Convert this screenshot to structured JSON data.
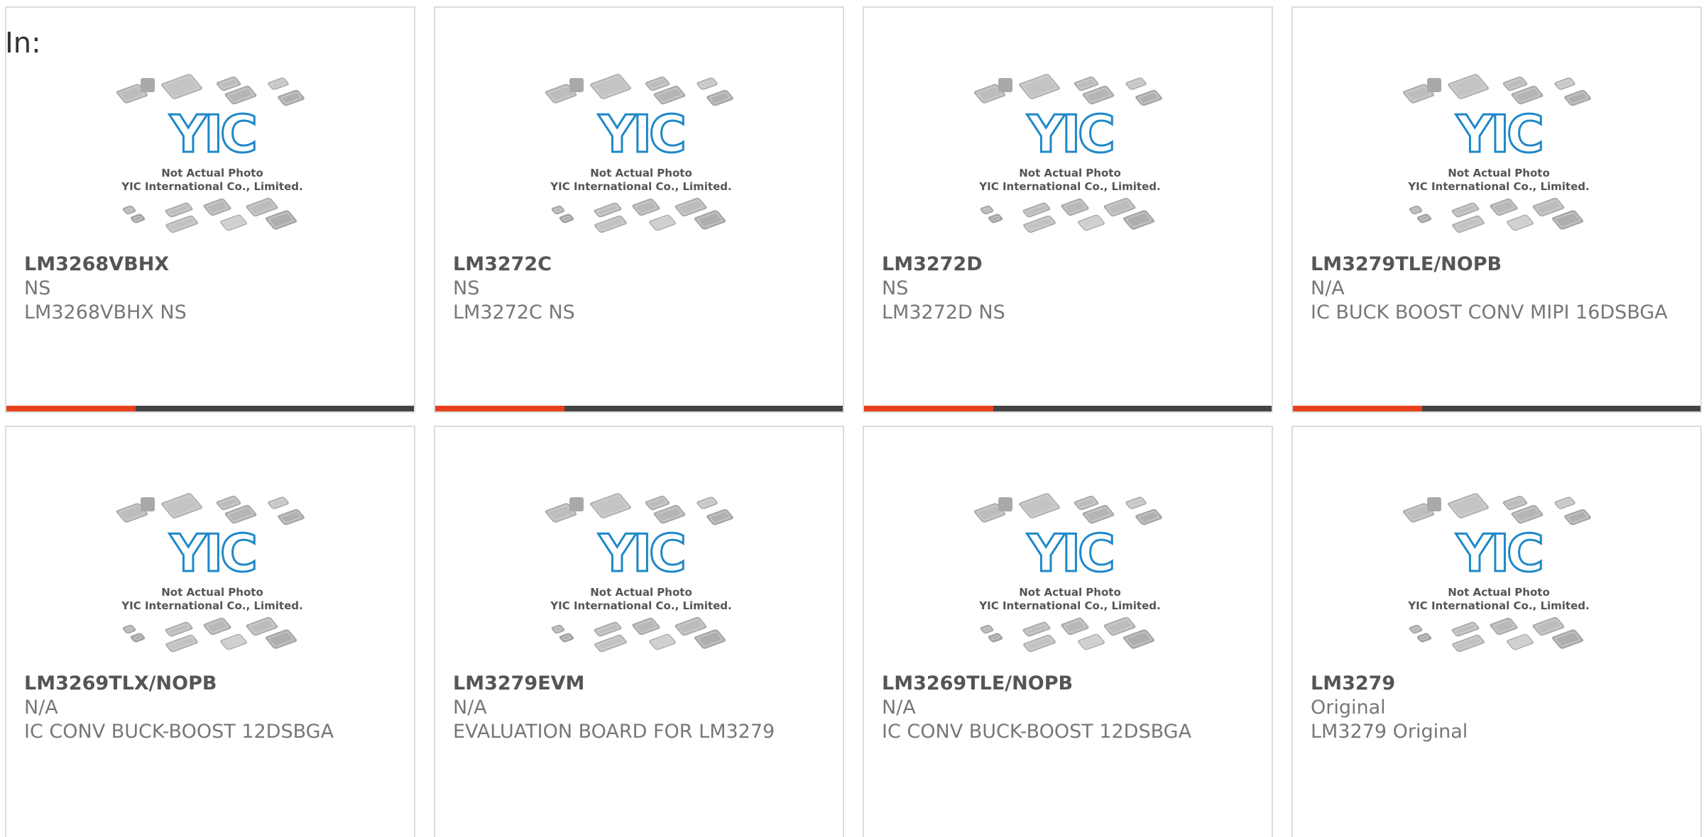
{
  "heading": {
    "label": "In:"
  },
  "colors": {
    "accent": "#e8401c",
    "bar": "#444444",
    "logo": "#1e88c8"
  },
  "placeholder": {
    "line1": "Not Actual Photo",
    "line2": "YIC International Co., Limited.",
    "logo_text": "YIC"
  },
  "cards": [
    {
      "part": "LM3268VBHX",
      "mfr": "NS",
      "desc": "LM3268VBHX NS"
    },
    {
      "part": "LM3272C",
      "mfr": "NS",
      "desc": "LM3272C NS"
    },
    {
      "part": "LM3272D",
      "mfr": "NS",
      "desc": "LM3272D NS"
    },
    {
      "part": "LM3279TLE/NOPB",
      "mfr": "N/A",
      "desc": "IC BUCK BOOST CONV MIPI 16DSBGA"
    },
    {
      "part": "LM3269TLX/NOPB",
      "mfr": "N/A",
      "desc": "IC CONV BUCK-BOOST 12DSBGA"
    },
    {
      "part": "LM3279EVM",
      "mfr": "N/A",
      "desc": "EVALUATION BOARD FOR LM3279"
    },
    {
      "part": "LM3269TLE/NOPB",
      "mfr": "N/A",
      "desc": "IC CONV BUCK-BOOST 12DSBGA"
    },
    {
      "part": "LM3279",
      "mfr": "Original",
      "desc": "LM3279 Original"
    }
  ]
}
